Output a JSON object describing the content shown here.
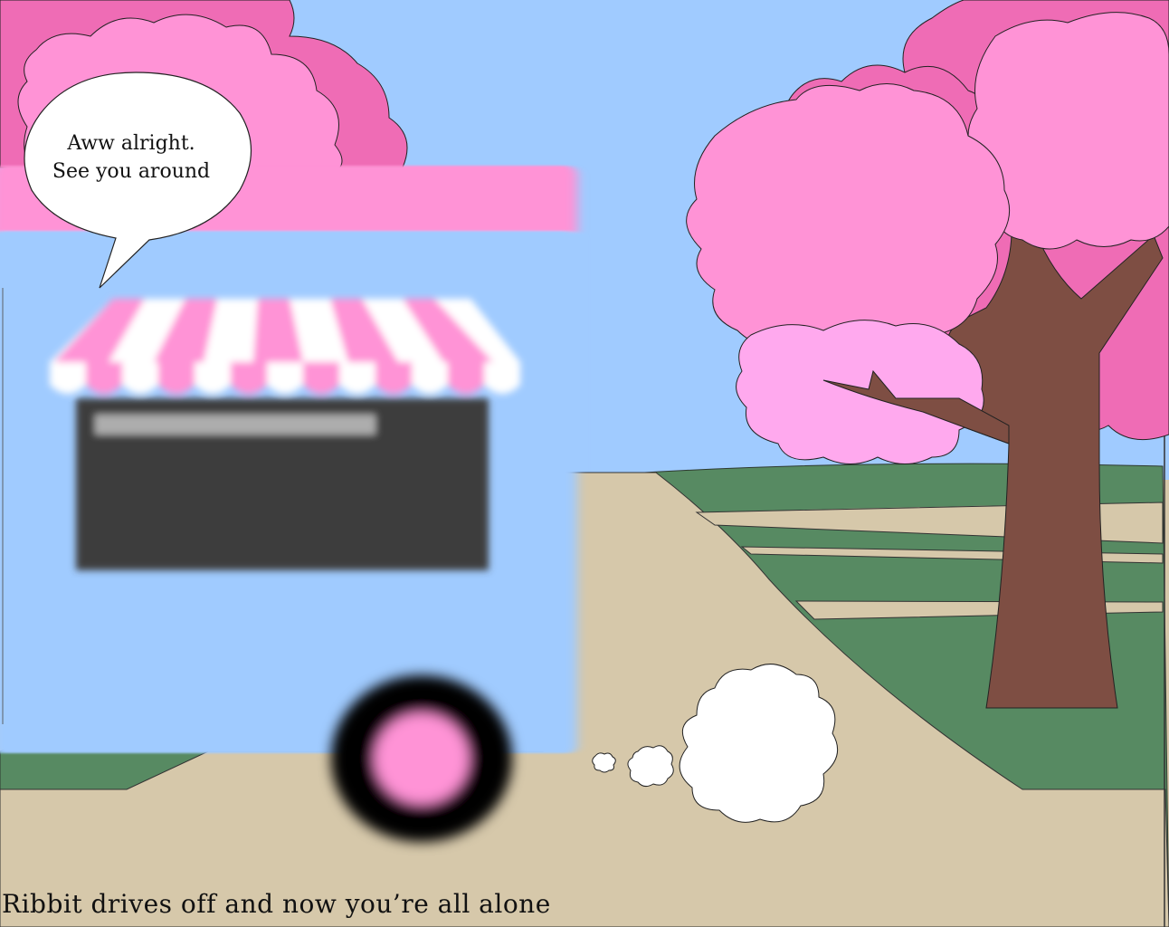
{
  "speech_bubble": {
    "line1": "Aww alright.",
    "line2": "See you around"
  },
  "narration": {
    "text": "Ribbit drives off and now you’re all alone"
  },
  "colors": {
    "sky": "#a0cbff",
    "blossom": "#ff93d6",
    "blossom_dark": "#ef6cb5",
    "blossom_light": "#ffa9ee",
    "grass": "#578a62",
    "path": "#d6c8aa",
    "trunk": "#7e4e43",
    "truck_body": "#a0cbff",
    "truck_roof": "#ff93d6",
    "chalkboard": "#3a3a3a"
  }
}
